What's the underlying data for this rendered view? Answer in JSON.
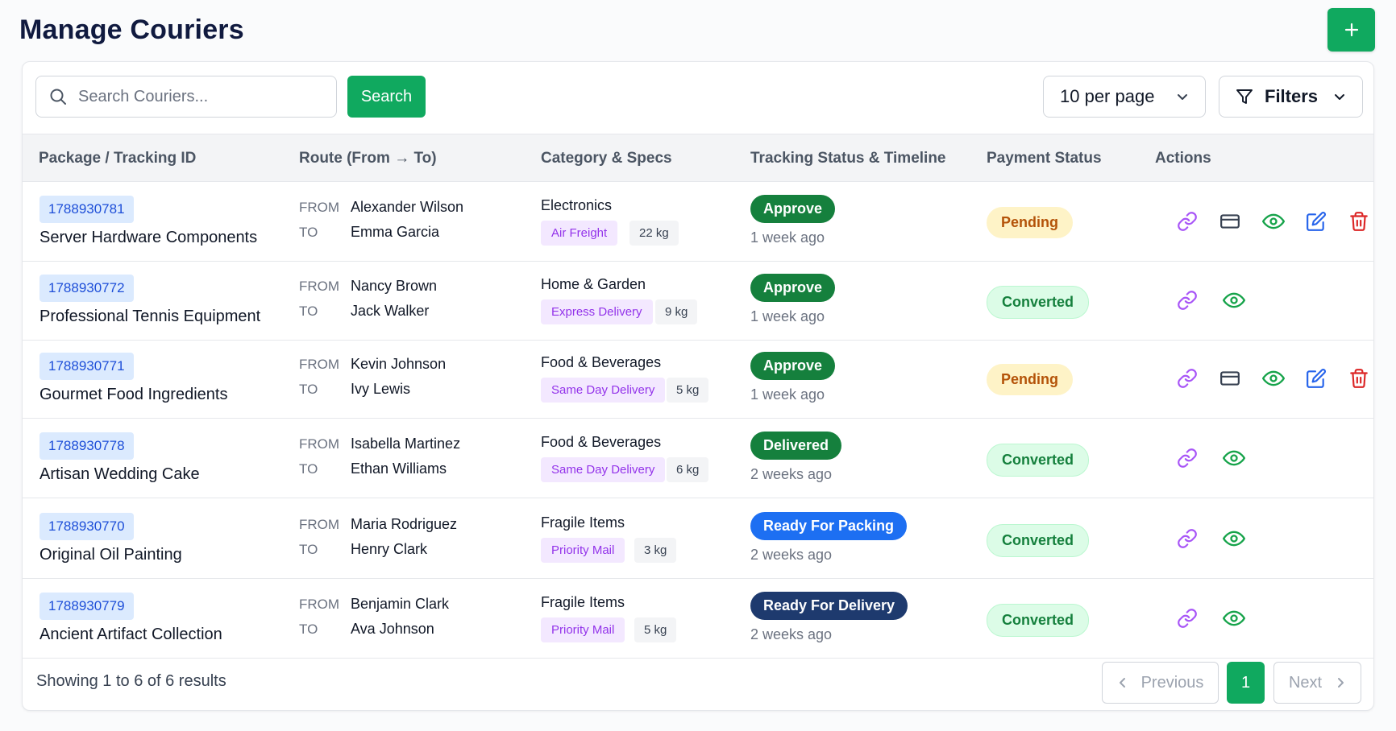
{
  "header": {
    "title": "Manage Couriers",
    "add_icon": "plus-icon"
  },
  "toolbar": {
    "search_placeholder": "Search Couriers...",
    "search_value": "",
    "search_label": "Search",
    "per_page": "10 per page",
    "filters_label": "Filters"
  },
  "table": {
    "columns": [
      "Package / Tracking ID",
      "Route (From → To)",
      "Category & Specs",
      "Tracking Status & Timeline",
      "Payment Status",
      "Actions"
    ],
    "route_from_label": "FROM",
    "route_to_label": "TO",
    "rows": [
      {
        "id": "1788930781",
        "name": "Server Hardware Components",
        "from": "Alexander Wilson",
        "to": "Emma Garcia",
        "category": "Electronics",
        "service": "Air Freight",
        "weight": "22 kg",
        "status": "Approve",
        "time": "1 week ago",
        "payment": "Pending"
      },
      {
        "id": "1788930772",
        "name": "Professional Tennis Equipment",
        "from": "Nancy Brown",
        "to": "Jack Walker",
        "category": "Home & Garden",
        "service": "Express Delivery",
        "weight": "9 kg",
        "status": "Approve",
        "time": "1 week ago",
        "payment": "Converted"
      },
      {
        "id": "1788930771",
        "name": "Gourmet Food Ingredients",
        "from": "Kevin Johnson",
        "to": "Ivy Lewis",
        "category": "Food & Beverages",
        "service": "Same Day Delivery",
        "weight": "5 kg",
        "status": "Approve",
        "time": "1 week ago",
        "payment": "Pending"
      },
      {
        "id": "1788930778",
        "name": "Artisan Wedding Cake",
        "from": "Isabella Martinez",
        "to": "Ethan Williams",
        "category": "Food & Beverages",
        "service": "Same Day Delivery",
        "weight": "6 kg",
        "status": "Delivered",
        "time": "2 weeks ago",
        "payment": "Converted"
      },
      {
        "id": "1788930770",
        "name": "Original Oil Painting",
        "from": "Maria Rodriguez",
        "to": "Henry Clark",
        "category": "Fragile Items",
        "service": "Priority Mail",
        "weight": "3 kg",
        "status": "Ready For Packing",
        "time": "2 weeks ago",
        "payment": "Converted"
      },
      {
        "id": "1788930779",
        "name": "Ancient Artifact Collection",
        "from": "Benjamin Clark",
        "to": "Ava Johnson",
        "category": "Fragile Items",
        "service": "Priority Mail",
        "weight": "5 kg",
        "status": "Ready For Delivery",
        "time": "2 weeks ago",
        "payment": "Converted"
      }
    ]
  },
  "footer": {
    "results": "Showing 1 to 6 of 6 results",
    "previous": "Previous",
    "current_page": "1",
    "next": "Next"
  },
  "colors": {
    "primary": "#10a95f",
    "approve": "#15803d",
    "delivered": "#15803d",
    "ready_packing": "#1d6ff2",
    "ready_delivery": "#1e3a6e",
    "link_icon": "#a855f7",
    "view_icon": "#16a34a",
    "edit_icon": "#2563eb",
    "delete_icon": "#dc2626"
  }
}
